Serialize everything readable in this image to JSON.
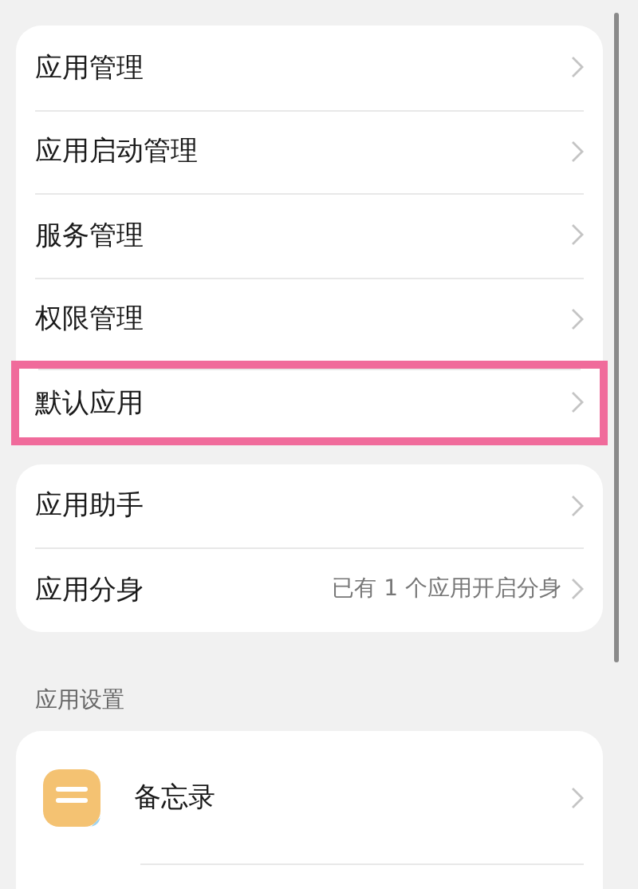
{
  "groups": [
    {
      "items": [
        {
          "label": "应用管理",
          "highlighted": false
        },
        {
          "label": "应用启动管理",
          "highlighted": false
        },
        {
          "label": "服务管理",
          "highlighted": false
        },
        {
          "label": "权限管理",
          "highlighted": false
        },
        {
          "label": "默认应用",
          "highlighted": true
        }
      ]
    },
    {
      "items": [
        {
          "label": "应用助手",
          "highlighted": false
        },
        {
          "label": "应用分身",
          "value": "已有 1 个应用开启分身",
          "highlighted": false
        }
      ]
    }
  ],
  "app_settings": {
    "header": "应用设置",
    "apps": [
      {
        "name": "备忘录"
      }
    ]
  }
}
